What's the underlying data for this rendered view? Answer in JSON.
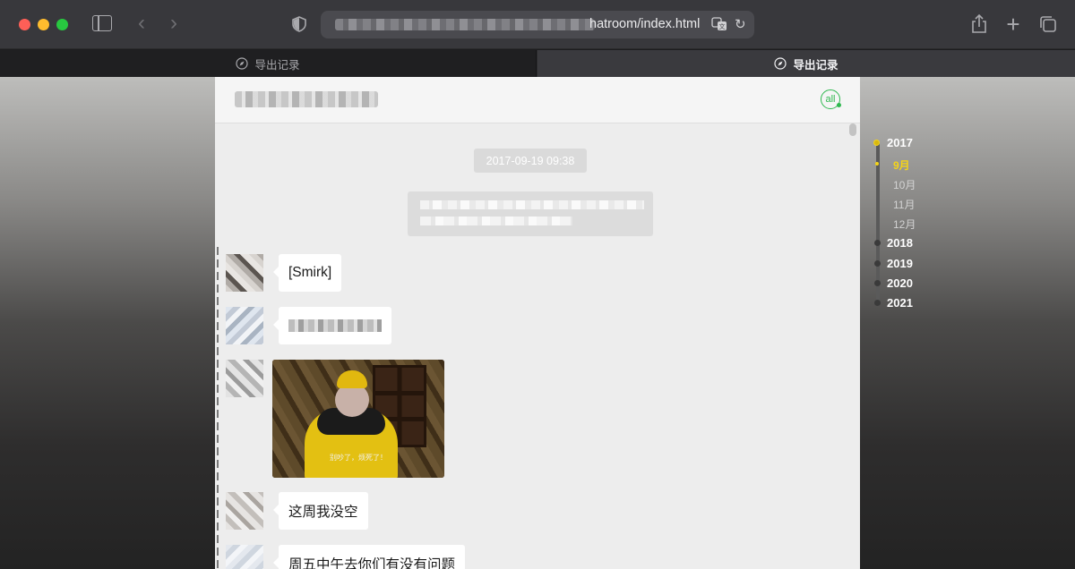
{
  "browser": {
    "address_visible_text": "hatroom/index.html"
  },
  "tabs": [
    {
      "label": "导出记录",
      "active": false
    },
    {
      "label": "导出记录",
      "active": true
    }
  ],
  "chat": {
    "header_action": "all",
    "timestamp": "2017-09-19 09:38",
    "messages": [
      {
        "type": "text",
        "text": "[Smirk]"
      },
      {
        "type": "text-blurred",
        "text": ""
      },
      {
        "type": "image",
        "caption": "别吵了，烦死了！"
      },
      {
        "type": "text",
        "text": "这周我没空"
      },
      {
        "type": "text",
        "text": "周五中午去你们有没有问题"
      }
    ]
  },
  "timeline": {
    "years": [
      "2017",
      "2018",
      "2019",
      "2020",
      "2021"
    ],
    "months_2017": [
      "9月",
      "10月",
      "11月",
      "12月"
    ],
    "active_month": "9月"
  },
  "colors": {
    "accent_green": "#2fb84f",
    "timeline_active": "#f5d417",
    "chat_bg": "#ededed"
  }
}
